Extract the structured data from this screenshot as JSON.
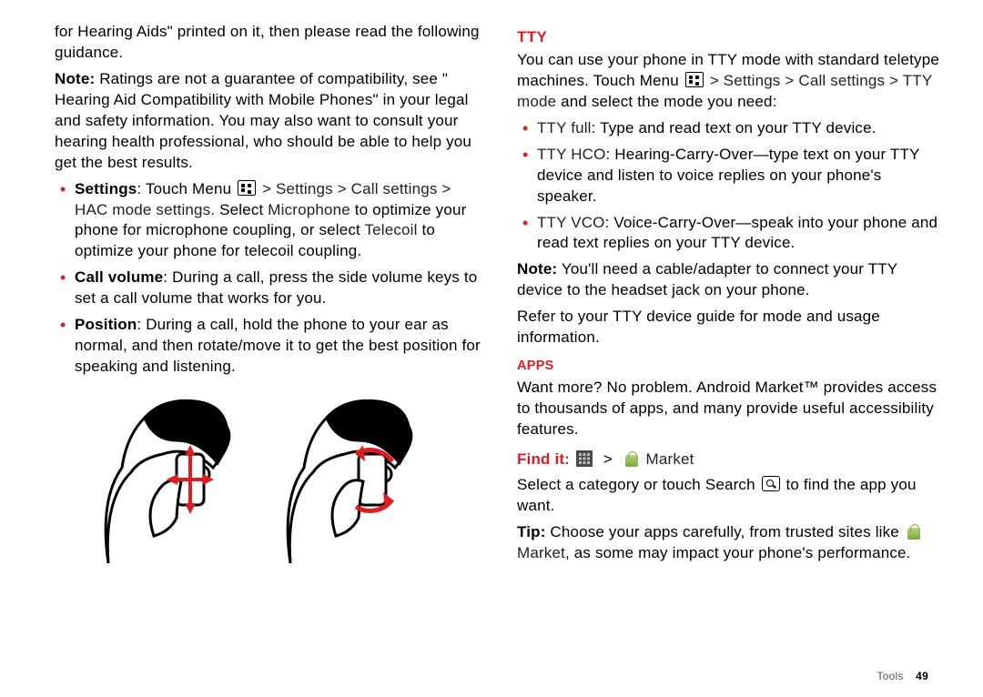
{
  "left": {
    "intro": "for Hearing Aids\" printed on it, then please read the following guidance.",
    "noteLabel": "Note:",
    "note": " Ratings are not a guarantee of compatibility, see \" Hearing Aid Compatibility with Mobile Phones\" in your legal and safety information. You may also want to consult your hearing health professional, who should be able to help you get the best results.",
    "items": [
      {
        "title": "Settings",
        "pre": ": Touch Menu ",
        "path1": " > Settings > Call settings > HAC mode settings.",
        "mid": " Select ",
        "opt1": "Microphone",
        "post1": " to optimize your phone for microphone coupling, or select ",
        "opt2": "Telecoil",
        "post2": " to optimize your phone for telecoil coupling."
      },
      {
        "title": "Call volume",
        "text": ": During a call, press the side volume keys to set a call volume that works for you."
      },
      {
        "title": "Position",
        "text": ": During a call, hold the phone to your ear as normal, and then rotate/move it to get the best position for speaking and listening."
      }
    ]
  },
  "right": {
    "ttyHeading": "TTY",
    "ttyIntroPre": "You can use your phone in TTY mode with standard teletype machines. Touch Menu ",
    "ttyIntroPath": " > Settings > Call settings > TTY mode",
    "ttyIntroPost": " and select the mode you need:",
    "ttyItems": [
      {
        "label": "TTY full",
        "text": ": Type and read text on your TTY device."
      },
      {
        "label": "TTY HCO",
        "text": ": Hearing-Carry-Over—type text on your TTY device and listen to voice replies on your phone's speaker."
      },
      {
        "label": "TTY VCO",
        "text": ": Voice-Carry-Over—speak into your phone and read text replies on your TTY device."
      }
    ],
    "ttyNoteLabel": "Note:",
    "ttyNote": " You'll need a cable/adapter to connect your TTY device to the headset jack on your phone.",
    "ttyRefer": "Refer to your TTY device guide for mode and usage information.",
    "appsHeading": "Apps",
    "appsIntro": "Want more? No problem. Android Market™ provides access to thousands of apps, and many provide useful accessibility features.",
    "findLabel": "Find it:",
    "marketLabel": " Market",
    "appsSelectPre": "Select a category or touch Search ",
    "appsSelectPost": " to find the app you want.",
    "tipLabel": "Tip:",
    "tipPre": " Choose your apps carefully, from trusted sites like ",
    "tipMarket": " Market",
    "tipPost": ", as some may impact your phone's performance."
  },
  "footer": {
    "section": "Tools",
    "page": "49"
  }
}
